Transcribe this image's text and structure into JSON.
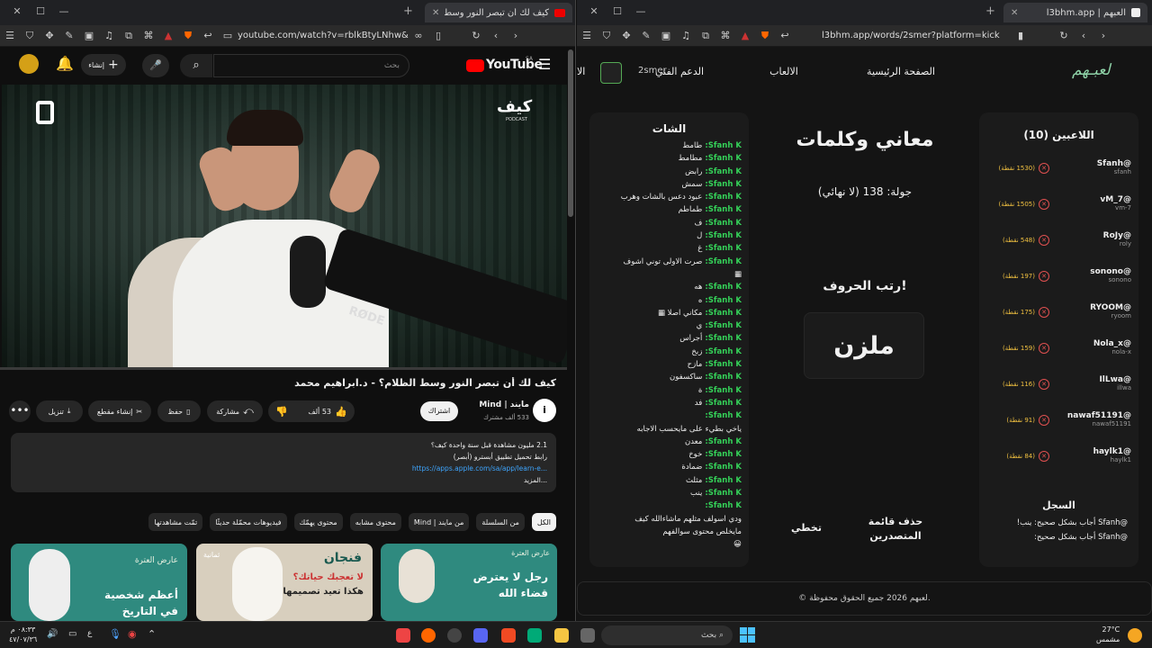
{
  "left": {
    "tab_title": "كيف لك أن تبصر النور وسط الظ",
    "url": "youtube.com/watch?v=rblkBtyLNhw&t=1...",
    "yt": {
      "logo": "YouTube",
      "region": "SA",
      "search_placeholder": "بحث",
      "create_label": "إنشاء"
    },
    "video": {
      "brand_logo": "كيف",
      "brand_sub": "PODCAST",
      "mic_brand": "RØDE",
      "title": "كيف لك أن تبصر النور وسط الظلام؟ - د.ابراهيم محمد",
      "channel": "مايند | Mind",
      "subscribers": "533 ألف مشترك",
      "subscribe_label": "اشتراك",
      "likes": "53 ألف",
      "share_label": "مشاركة",
      "save_label": "حفظ",
      "clip_label": "إنشاء مقطع",
      "download_label": "تنزيل"
    },
    "desc": {
      "line1": "2.1 مليون مشاهدة قبل سنة واحدة كيف؟",
      "line2": "رابط تحميل تطبيق أبسترو (أبصر)",
      "link": "https://apps.apple.com/sa/app/learn-e...",
      "more": "...المزيد"
    },
    "chips": [
      "الكل",
      "من السلسلة",
      "من مايند | Mind",
      "محتوى مشابه",
      "محتوى يهمّك",
      "فيديوهات محمّلة حديثًا",
      "تمّت مشاهدتها"
    ],
    "thumbs": [
      {
        "t1": "رجل لا يعترض",
        "t2": "قضاء الله",
        "badge": "عارض العترة",
        "bg": "#2f8a7f"
      },
      {
        "t1": "لا تعجبك حياتك؟",
        "t2": "هكذا تعيد تصميمها",
        "badge": "فنجان",
        "tag": "ثمانية",
        "bg": "#d8cfbe"
      },
      {
        "t1": "أعظم شخصية",
        "t2": "في التاريخ",
        "badge": "عارض العترة",
        "bg": "#2f8a7f"
      }
    ]
  },
  "right": {
    "tab_title": "العبهم | l3bhm.app",
    "url": "l3bhm.app/words/2smer?platform=kick",
    "nav": {
      "logo": "لعبـهم",
      "home": "الصفحة الرئيسية",
      "games": "الالعاب",
      "support": "الدعم الفني",
      "user": "2smer",
      "extra": "الا"
    },
    "players_title": "اللاعبين (10)",
    "players": [
      {
        "name": "@Sfanh",
        "sub": "sfanh",
        "pts": "(1530 نقطة)"
      },
      {
        "name": "@vM_7",
        "sub": "vm-7",
        "pts": "(1505 نقطة)"
      },
      {
        "name": "@RoJy",
        "sub": "roly",
        "pts": "(548 نقطة)"
      },
      {
        "name": "@sonono",
        "sub": "sonono",
        "pts": "(197 نقطة)"
      },
      {
        "name": "@RYOOM",
        "sub": "ryoom",
        "pts": "(175 نقطة)"
      },
      {
        "name": "@Nola_x",
        "sub": "nola-x",
        "pts": "(159 نقطة)"
      },
      {
        "name": "@IlLwa",
        "sub": "illwa",
        "pts": "(116 نقطة)"
      },
      {
        "name": "@nawaf51191",
        "sub": "nawaf51191",
        "pts": "(91 نقطة)"
      },
      {
        "name": "@haylk1",
        "sub": "haylk1",
        "pts": "(84 نقطة)"
      }
    ],
    "log_title": "السجل",
    "log": [
      "@Sfanh أجاب بشكل صحيح: ينب!",
      "@Sfanh أجاب بشكل صحيح:"
    ],
    "game": {
      "title": "معاني وكلمات",
      "round": "جولة: 138 (لا نهائي)",
      "prompt": "رتب الحروف!",
      "word": "ملزن",
      "skip": "تخطي",
      "clear": "حذف قائمة المتصدرين"
    },
    "chat_title": "الشات",
    "chat": [
      {
        "u": "Sfanh:",
        "m": "طامط"
      },
      {
        "u": "Sfanh:",
        "m": "مطامط"
      },
      {
        "u": "Sfanh:",
        "m": "رابض"
      },
      {
        "u": "Sfanh:",
        "m": "سمش"
      },
      {
        "u": "Sfanh:",
        "m": "عبود دعس بالشات وهرب"
      },
      {
        "u": "Sfanh:",
        "m": "طماطم"
      },
      {
        "u": "Sfanh:",
        "m": "ف"
      },
      {
        "u": "Sfanh:",
        "m": "ل"
      },
      {
        "u": "Sfanh:",
        "m": "غ"
      },
      {
        "u": "Sfanh:",
        "m": "صرت الاولى توني اشوف"
      },
      {
        "u": "",
        "m": "▦"
      },
      {
        "u": "Sfanh:",
        "m": "هه"
      },
      {
        "u": "Sfanh:",
        "m": "ه"
      },
      {
        "u": "Sfanh:",
        "m": "مكاني اصلا ▦"
      },
      {
        "u": "Sfanh:",
        "m": "ي"
      },
      {
        "u": "Sfanh:",
        "m": "أجراس"
      },
      {
        "u": "Sfanh:",
        "m": "زبخ"
      },
      {
        "u": "Sfanh:",
        "m": "مازح"
      },
      {
        "u": "Sfanh:",
        "m": "ساكسفون"
      },
      {
        "u": "Sfanh:",
        "m": "ة"
      },
      {
        "u": "Sfanh:",
        "m": "فد"
      },
      {
        "u": "Sfanh:",
        "m": ""
      },
      {
        "u": "",
        "m": "ياخي بطيء على مايحسب الاجابه"
      },
      {
        "u": "Sfanh:",
        "m": "معدن"
      },
      {
        "u": "Sfanh:",
        "m": "خوخ"
      },
      {
        "u": "Sfanh:",
        "m": "ضمادة"
      },
      {
        "u": "Sfanh:",
        "m": "مثلث"
      },
      {
        "u": "Sfanh:",
        "m": "ينب"
      },
      {
        "u": "Sfanh:",
        "m": ""
      },
      {
        "u": "",
        "m": "ودي اسولف مثلهم ماشاءالله كيف"
      },
      {
        "u": "",
        "m": "مايخلص محتوى سوالفهم"
      },
      {
        "u": "",
        "m": "😀"
      }
    ],
    "footer": "© لعبهم 2026 جميع الحقوق محفوظة."
  },
  "taskbar": {
    "search": "بحث",
    "weather_temp": "27°C",
    "weather_desc": "مشمس",
    "time": "٠٨:٣٣ م",
    "date": "٤٧/٠٧/٣٦",
    "lang": "ع"
  }
}
